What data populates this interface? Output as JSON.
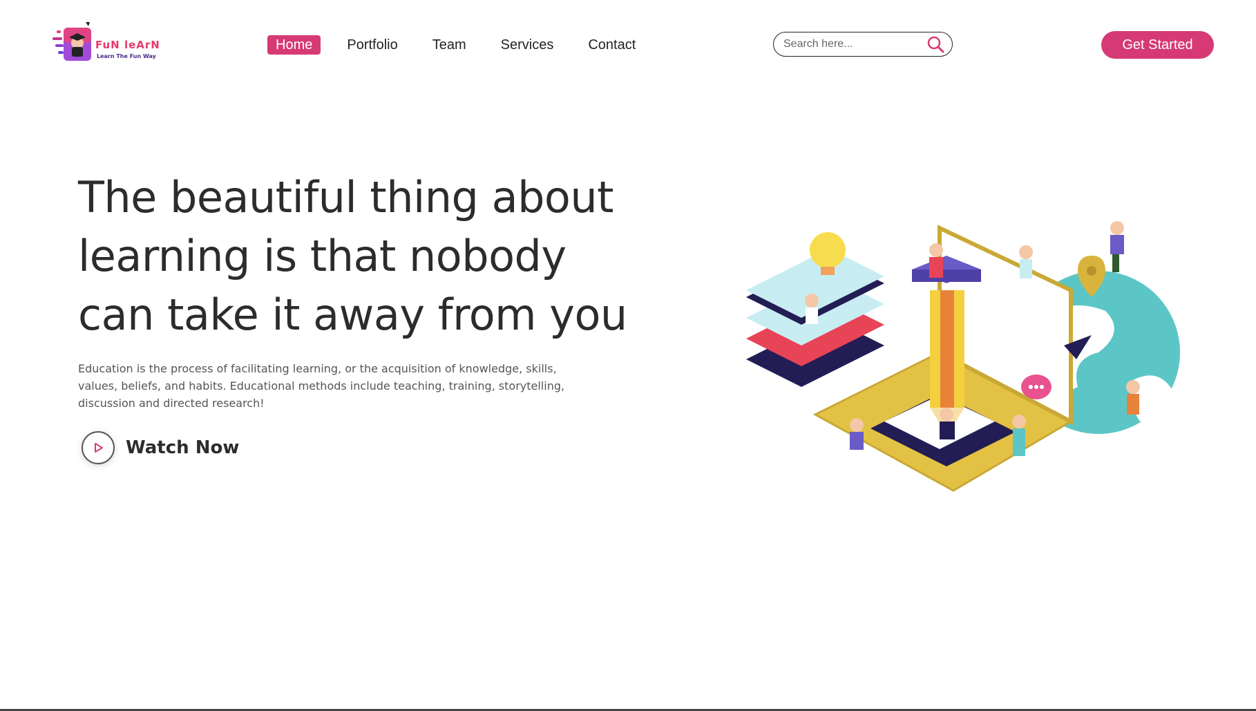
{
  "brand": {
    "name": "FuN leArN",
    "tagline": "Learn The Fun Way"
  },
  "nav": {
    "items": [
      {
        "label": "Home",
        "active": true
      },
      {
        "label": "Portfolio",
        "active": false
      },
      {
        "label": "Team",
        "active": false
      },
      {
        "label": "Services",
        "active": false
      },
      {
        "label": "Contact",
        "active": false
      }
    ]
  },
  "search": {
    "placeholder": "Search here...",
    "value": ""
  },
  "header": {
    "cta_label": "Get Started"
  },
  "hero": {
    "title": "The beautiful thing about learning is that nobody can take it away from you",
    "description": "Education is the process of facilitating learning, or the acquisition of knowledge, skills, values, beliefs, and habits. Educational methods include teaching, training, storytelling, discussion and directed research!",
    "watch_label": "Watch Now"
  },
  "colors": {
    "accent": "#d63a74",
    "text": "#2c2c2c",
    "muted": "#555555"
  },
  "icons": {
    "search": "search-icon",
    "play": "play-icon"
  }
}
